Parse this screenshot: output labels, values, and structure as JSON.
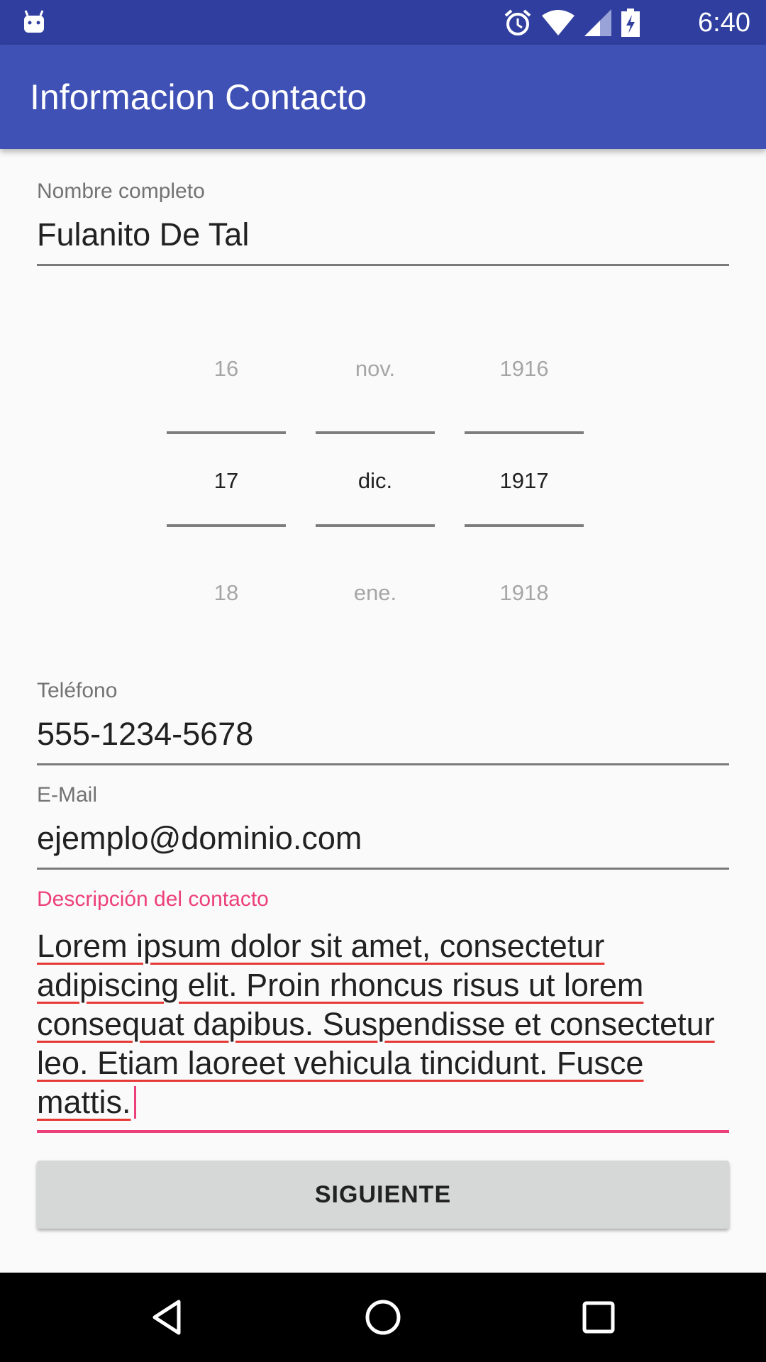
{
  "status_bar": {
    "time": "6:40",
    "icons": [
      "android-robot-icon",
      "alarm-icon",
      "wifi-icon",
      "signal-icon",
      "battery-charging-icon"
    ]
  },
  "app_bar": {
    "title": "Informacion Contacto"
  },
  "form": {
    "name": {
      "label": "Nombre completo",
      "value": "Fulanito De Tal"
    },
    "date_picker": {
      "day": {
        "prev": "16",
        "selected": "17",
        "next": "18"
      },
      "month": {
        "prev": "nov.",
        "selected": "dic.",
        "next": "ene."
      },
      "year": {
        "prev": "1916",
        "selected": "1917",
        "next": "1918"
      }
    },
    "phone": {
      "label": "Teléfono",
      "value": "555-1234-5678"
    },
    "email": {
      "label": "E-Mail",
      "value": "ejemplo@dominio.com"
    },
    "description": {
      "label": "Descripción del contacto",
      "value": "Lorem ipsum dolor sit amet, consectetur adipiscing elit. Proin rhoncus risus ut lorem consequat dapibus. Suspendisse et consectetur leo. Etiam laoreet vehicula tincidunt. Fusce mattis."
    },
    "next_button": "SIGUIENTE"
  },
  "colors": {
    "status_bar": "#303f9f",
    "app_bar": "#3f51b5",
    "accent": "#ec407a",
    "spellcheck": "#e53935"
  },
  "nav_bar": {
    "icons": [
      "back-icon",
      "home-icon",
      "recents-icon"
    ]
  }
}
